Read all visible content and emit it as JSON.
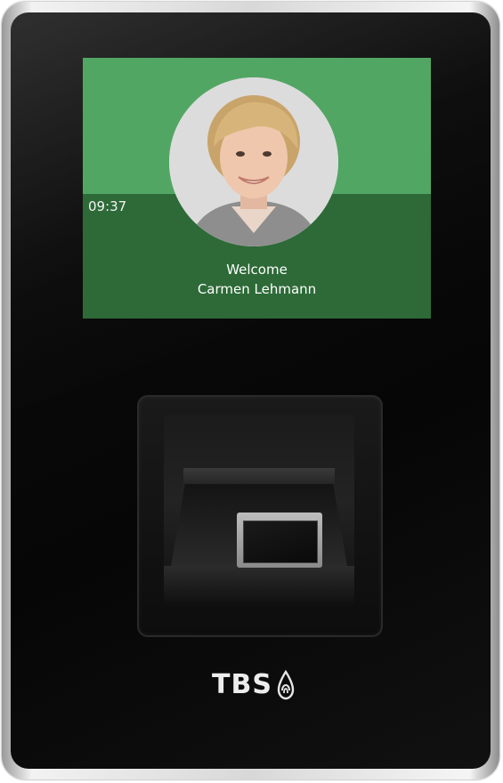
{
  "screen": {
    "time": "09:37",
    "greeting": "Welcome",
    "user_name": "Carmen Lehmann",
    "colors": {
      "top_band": "#52a664",
      "bottom_band": "#2d6a37"
    }
  },
  "device": {
    "brand": "TBS",
    "logo_icon": "fingerprint-drop-icon"
  }
}
